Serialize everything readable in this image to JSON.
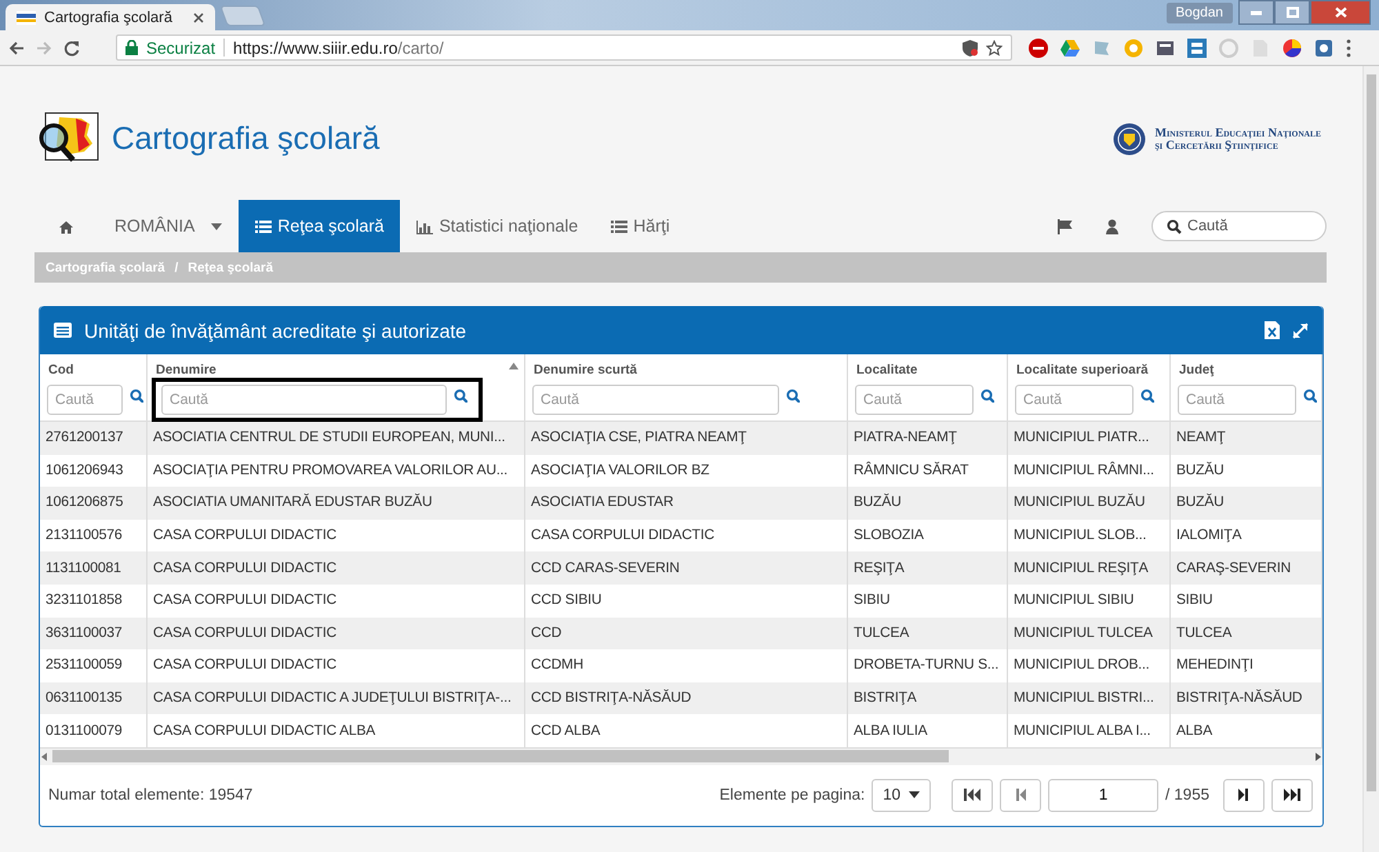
{
  "browser": {
    "tab_title": "Cartografia şcolară",
    "user": "Bogdan",
    "security": "Securizat",
    "url_host": "https://www.siiir.edu.ro",
    "url_path": "/carto/"
  },
  "site": {
    "title": "Cartografia şcolară",
    "ministry": [
      "Ministerul Educaţiei Naţionale",
      "şi Cercetării Ştiinţifice"
    ]
  },
  "nav": {
    "items": [
      {
        "kind": "home",
        "selected": false
      },
      {
        "kind": "dropdown",
        "label": "ROMÂNIA",
        "selected": false
      },
      {
        "kind": "list",
        "label": "Reţea şcolară",
        "selected": true
      },
      {
        "kind": "chart",
        "label": "Statistici naţionale",
        "selected": false
      },
      {
        "kind": "list",
        "label": "Hărţi",
        "selected": false
      }
    ],
    "search_placeholder": "Caută"
  },
  "breadcrumb": {
    "items": [
      "Cartografia şcolară",
      "Reţea şcolară"
    ],
    "separator": "/"
  },
  "panel": {
    "title": "Unităţi de învăţământ acreditate şi autorizate",
    "columns": [
      {
        "label": "Cod",
        "placeholder": "Caută",
        "sorted": false,
        "highlighted": false
      },
      {
        "label": "Denumire",
        "placeholder": "Caută",
        "sorted": true,
        "highlighted": true
      },
      {
        "label": "Denumire scurtă",
        "placeholder": "Caută",
        "sorted": false,
        "highlighted": false
      },
      {
        "label": "Localitate",
        "placeholder": "Caută",
        "sorted": false,
        "highlighted": false
      },
      {
        "label": "Localitate superioară",
        "placeholder": "Caută",
        "sorted": false,
        "highlighted": false
      },
      {
        "label": "Judeţ",
        "placeholder": "Caută",
        "sorted": false,
        "highlighted": false
      }
    ],
    "rows": [
      [
        "2761200137",
        "ASOCIATIA CENTRUL DE STUDII EUROPEAN, MUNI...",
        "ASOCIAŢIA CSE, PIATRA NEAMŢ",
        "PIATRA-NEAMŢ",
        "MUNICIPIUL PIATR...",
        "NEAMŢ"
      ],
      [
        "1061206943",
        "ASOCIAŢIA PENTRU PROMOVAREA VALORILOR AU...",
        "ASOCIAŢIA VALORILOR BZ",
        "RÂMNICU SĂRAT",
        "MUNICIPIUL RÂMNI...",
        "BUZĂU"
      ],
      [
        "1061206875",
        "ASOCIATIA UMANITARĂ EDUSTAR BUZĂU",
        "ASOCIATIA EDUSTAR",
        "BUZĂU",
        "MUNICIPIUL BUZĂU",
        "BUZĂU"
      ],
      [
        "2131100576",
        "CASA CORPULUI DIDACTIC",
        "CASA CORPULUI DIDACTIC",
        "SLOBOZIA",
        "MUNICIPIUL SLOB...",
        "IALOMIŢA"
      ],
      [
        "1131100081",
        "CASA CORPULUI DIDACTIC",
        "CCD CARAS-SEVERIN",
        "REŞIŢA",
        "MUNICIPIUL REŞIŢA",
        "CARAŞ-SEVERIN"
      ],
      [
        "3231101858",
        "CASA CORPULUI DIDACTIC",
        "CCD SIBIU",
        "SIBIU",
        "MUNICIPIUL SIBIU",
        "SIBIU"
      ],
      [
        "3631100037",
        "CASA CORPULUI DIDACTIC",
        "CCD",
        "TULCEA",
        "MUNICIPIUL TULCEA",
        "TULCEA"
      ],
      [
        "2531100059",
        "CASA CORPULUI DIDACTIC",
        "CCDMH",
        "DROBETA-TURNU S...",
        "MUNICIPIUL DROB...",
        "MEHEDINŢI"
      ],
      [
        "0631100135",
        "CASA CORPULUI DIDACTIC A JUDEŢULUI BISTRIŢA-...",
        "CCD BISTRIŢA-NĂSĂUD",
        "BISTRIŢA",
        "MUNICIPIUL BISTRI...",
        "BISTRIŢA-NĂSĂUD"
      ],
      [
        "0131100079",
        "CASA CORPULUI DIDACTIC ALBA",
        "CCD ALBA",
        "ALBA IULIA",
        "MUNICIPIUL ALBA I...",
        "ALBA"
      ]
    ],
    "total": "Numar total elemente: 19547",
    "page_size_label": "Elemente pe pagina:",
    "page_size": "10",
    "page": "1",
    "page_count": "/ 1955"
  }
}
